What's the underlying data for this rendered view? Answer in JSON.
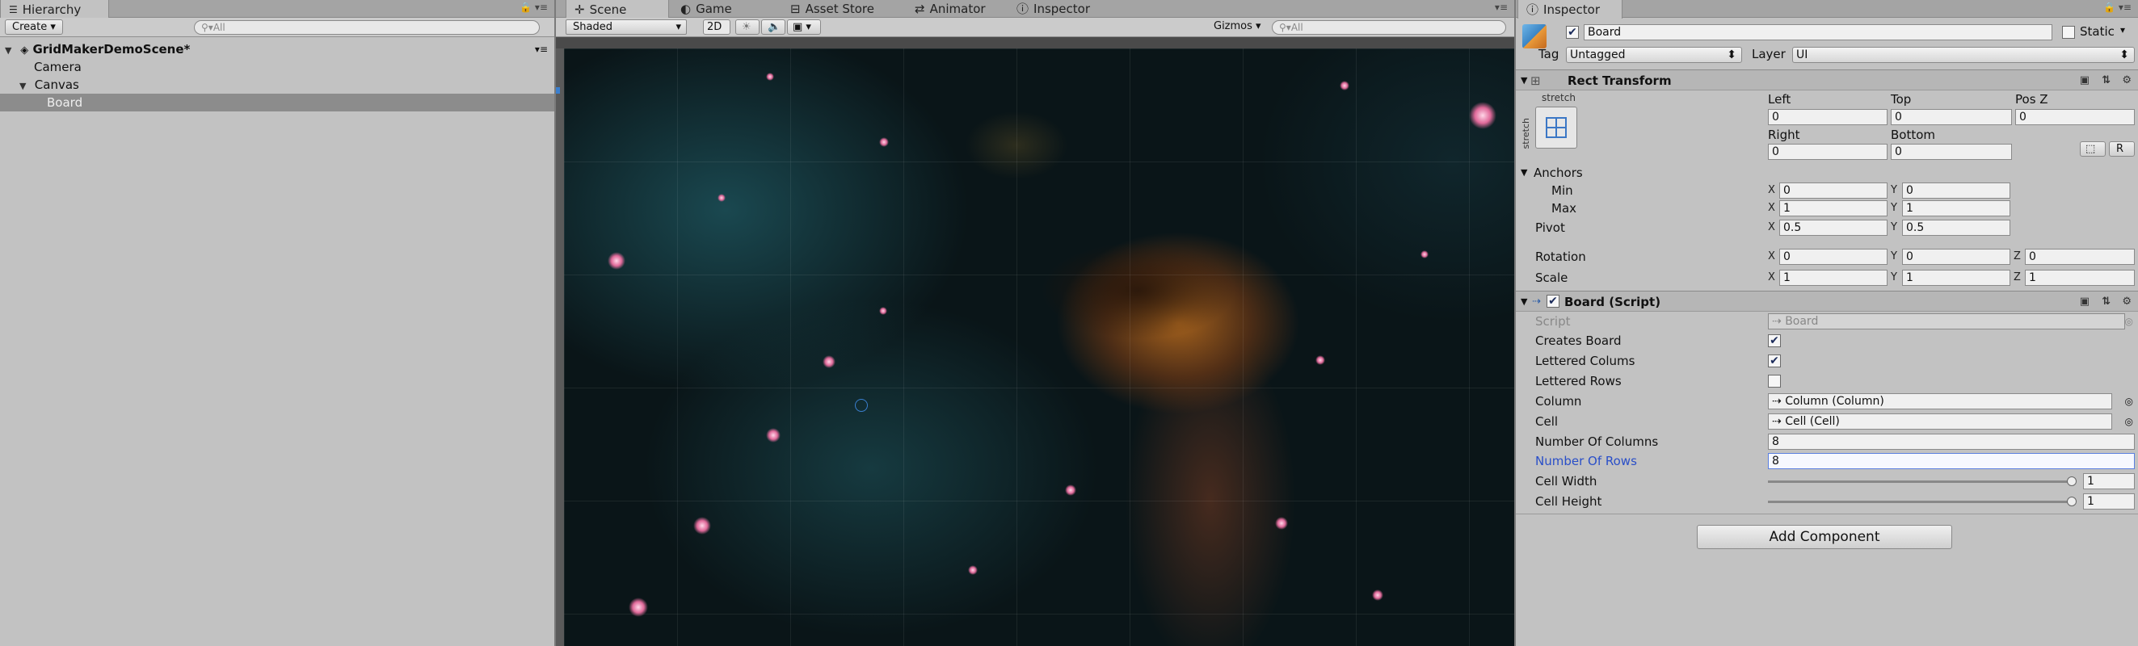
{
  "hierarchy": {
    "tab": "Hierarchy",
    "create": "Create",
    "search_placeholder": "All",
    "scene": "GridMakerDemoScene*",
    "items": [
      {
        "label": "Camera"
      },
      {
        "label": "Canvas"
      },
      {
        "label": "Board"
      }
    ]
  },
  "scene": {
    "tabs": [
      {
        "label": "Scene"
      },
      {
        "label": "Game"
      },
      {
        "label": "Asset Store"
      },
      {
        "label": "Animator"
      },
      {
        "label": "Inspector"
      }
    ],
    "shading": "Shaded",
    "mode2d": "2D",
    "gizmos": "Gizmos",
    "search_placeholder": "All"
  },
  "inspector": {
    "tab": "Inspector",
    "object_name": "Board",
    "static_label": "Static",
    "tag_label": "Tag",
    "tag_value": "Untagged",
    "layer_label": "Layer",
    "layer_value": "UI",
    "rect": {
      "title": "Rect Transform",
      "stretch": "stretch",
      "stretch_v": "stretch",
      "left_label": "Left",
      "top_label": "Top",
      "posz_label": "Pos Z",
      "left": "0",
      "top": "0",
      "posz": "0",
      "right_label": "Right",
      "bottom_label": "Bottom",
      "right": "0",
      "bottom": "0",
      "r_btn": "R",
      "anchors_label": "Anchors",
      "min_label": "Min",
      "max_label": "Max",
      "min_x": "0",
      "min_y": "0",
      "max_x": "1",
      "max_y": "1",
      "pivot_label": "Pivot",
      "pivot_x": "0.5",
      "pivot_y": "0.5",
      "rotation_label": "Rotation",
      "rot_x": "0",
      "rot_y": "0",
      "rot_z": "0",
      "scale_label": "Scale",
      "scale_x": "1",
      "scale_y": "1",
      "scale_z": "1",
      "x": "X",
      "y": "Y",
      "z": "Z"
    },
    "script": {
      "title": "Board (Script)",
      "script_label": "Script",
      "script_value": "Board",
      "creates_board": "Creates Board",
      "lettered_columns": "Lettered Colums",
      "lettered_rows": "Lettered Rows",
      "creates_board_checked": true,
      "lettered_columns_checked": true,
      "lettered_rows_checked": false,
      "column_label": "Column",
      "column_value": "Column (Column)",
      "cell_label": "Cell",
      "cell_value": "Cell (Cell)",
      "num_columns_label": "Number Of Columns",
      "num_columns": "8",
      "num_rows_label": "Number Of Rows",
      "num_rows": "8",
      "cell_width_label": "Cell Width",
      "cell_width": "1",
      "cell_height_label": "Cell Height",
      "cell_height": "1"
    },
    "add_component": "Add Component"
  }
}
